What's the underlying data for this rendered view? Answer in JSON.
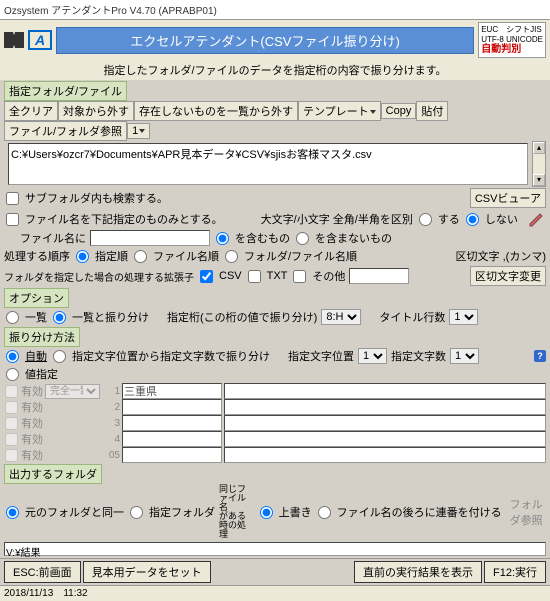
{
  "window": {
    "title": "Ozsystem アテンダントPro V4.70 (APRABP01)"
  },
  "header": {
    "banner": "エクセルアテンダント(CSVファイル振り分け)",
    "subtitle": "指定したフォルダ/ファイルのデータを指定桁の内容で振り分けます。",
    "enc_line1": "EUC　シフトJIS",
    "enc_line2": "UTF-8 UNICODE",
    "enc_auto": "自動判別"
  },
  "sec1": {
    "label": "指定フォルダ/ファイル",
    "btn_clear": "全クリア",
    "btn_exclude": "対象から外す",
    "btn_noexist": "存在しないものを一覧から外す",
    "btn_template": "テンプレート",
    "btn_copy": "Copy",
    "btn_paste": "貼付",
    "btn_ref": "ファイル/フォルダ参照",
    "path": "C:¥Users¥ozcr7¥Documents¥APR見本データ¥CSV¥sjisお客様マスタ.csv"
  },
  "opts": {
    "subfolder": "サブフォルダ内も検索する。",
    "filename_only": "ファイル名を下記指定のものみとする。",
    "filename_label": "ファイル名に",
    "csvviewer": "CSVビューア",
    "case_label": "大文字/小文字 全角/半角を区別",
    "case_yes": "する",
    "case_no": "しない",
    "include_yes": "を含むもの",
    "include_no": "を含まないもの",
    "order_label": "処理する順序",
    "order1": "指定順",
    "order2": "ファイル名順",
    "order3": "フォルダ/ファイル名順",
    "ext_label": "フォルダを指定した場合の処理する拡張子",
    "ext_csv": "CSV",
    "ext_txt": "TXT",
    "ext_other": "その他",
    "delim_label": "区切文字 ,(カンマ)",
    "delim_btn": "区切文字変更"
  },
  "option": {
    "label": "オプション",
    "r1": "一覧",
    "r2": "一覧と振り分け",
    "col_label": "指定桁(この桁の値で振り分け)",
    "col_val": "8:H",
    "title_rows": "タイトル行数",
    "title_val": "1"
  },
  "split": {
    "label": "振り分け方法",
    "r1": "自動",
    "r2": "指定文字位置から指定文字数で振り分け",
    "pos_label": "指定文字位置",
    "pos_val": "1",
    "cnt_label": "指定文字数",
    "cnt_val": "1",
    "r3": "値指定",
    "valid": "有効",
    "match": "完全一致",
    "sample": "三重県",
    "nums": [
      "1",
      "2",
      "3",
      "4",
      "05"
    ]
  },
  "out": {
    "label": "出力するフォルダ",
    "r1": "元のフォルダと同一",
    "r2": "指定フォルダ",
    "r3a": "同じファイル名",
    "r3b": "がある時の処理",
    "r4": "上書き",
    "r5": "ファイル名の後ろに連番を付ける",
    "ref": "フォルダ参照",
    "result": "V:¥結果"
  },
  "footer": {
    "esc": "ESC:前画面",
    "sample": "見本用データをセット",
    "prev": "直前の実行結果を表示",
    "run": "F12:実行"
  },
  "status": {
    "date": "2018/11/13",
    "time": "11:32"
  }
}
